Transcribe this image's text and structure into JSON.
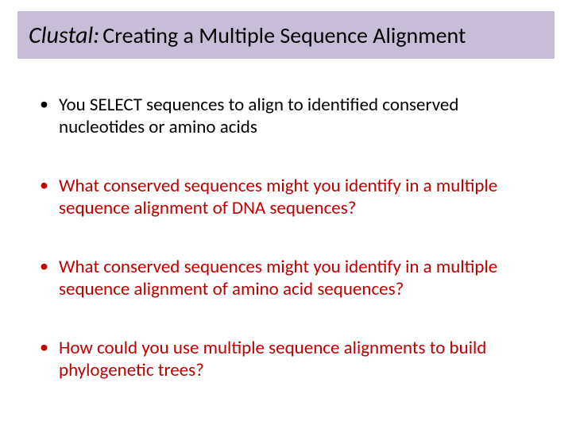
{
  "title": {
    "prefix": "Clustal:",
    "rest": "Creating a Multiple Sequence Alignment"
  },
  "bullets": [
    {
      "text": "You SELECT sequences to align to identified conserved nucleotides or amino acids",
      "color": "black"
    },
    {
      "text": "What conserved sequences might you identify in a multiple sequence alignment of DNA sequences?",
      "color": "red"
    },
    {
      "text": "What conserved sequences might you identify in a multiple sequence alignment of amino acid sequences?",
      "color": "red"
    },
    {
      "text": "How could you use multiple sequence alignments to build phylogenetic trees?",
      "color": "red"
    }
  ]
}
